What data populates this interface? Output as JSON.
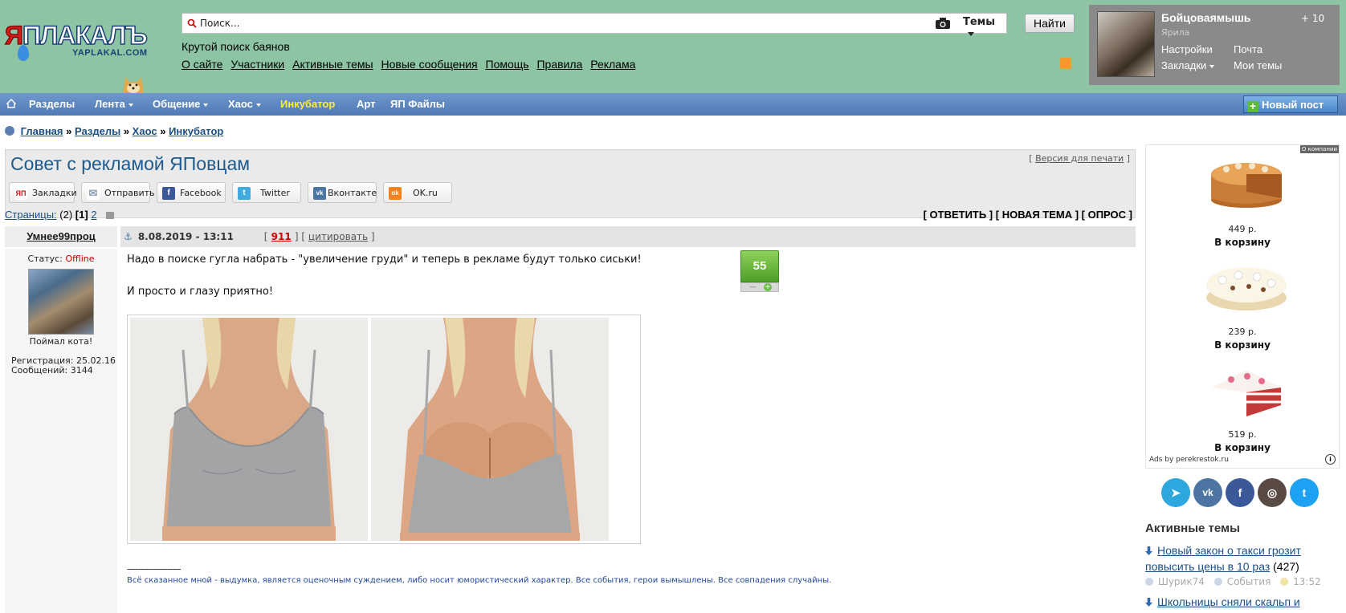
{
  "logo": {
    "main": "ЯПЛАКАЛЪ",
    "sub": "YAPLAKAL.COM"
  },
  "search": {
    "placeholder": "Поиск...",
    "scope_label": "Темы",
    "button": "Найти"
  },
  "tagline": "Крутой поиск баянов",
  "top_nav": [
    "О сайте",
    "Участники",
    "Активные темы",
    "Новые сообщения",
    "Помощь",
    "Правила",
    "Реклама"
  ],
  "user_panel": {
    "name": "Бойцоваямышь",
    "sub": "Ярила",
    "settings": "Настройки",
    "mail": "Почта",
    "bookmarks": "Закладки",
    "my_topics": "Мои темы",
    "icons_text": "+ 10"
  },
  "main_nav": [
    {
      "label": "Разделы",
      "caret": false
    },
    {
      "label": "Лента",
      "caret": true
    },
    {
      "label": "Общение",
      "caret": true
    },
    {
      "label": "Хаос",
      "caret": true
    },
    {
      "label": "Инкубатор",
      "caret": false,
      "highlight": true
    },
    {
      "label": "Арт",
      "caret": false
    },
    {
      "label": "ЯП Файлы",
      "caret": false
    }
  ],
  "new_post_button": "Новый пост",
  "breadcrumb": [
    "Главная",
    "Разделы",
    "Хаос",
    "Инкубатор"
  ],
  "breadcrumb_sep": "»",
  "topic": {
    "title": "Совет с рекламой ЯПовцам",
    "print_version": "Версия для печати",
    "share": [
      {
        "label": "Закладки",
        "icon": "yap-icon",
        "color": "#c41a1a",
        "glyph": "ЯП"
      },
      {
        "label": "Отправить",
        "icon": "mail-icon",
        "color": "#8aa0b8",
        "glyph": "✉"
      },
      {
        "label": "Facebook",
        "icon": "facebook-icon",
        "color": "#3b5998",
        "glyph": "f"
      },
      {
        "label": "Twitter",
        "icon": "twitter-icon",
        "color": "#41abe1",
        "glyph": "t"
      },
      {
        "label": "Вконтакте",
        "icon": "vk-icon",
        "color": "#4c75a3",
        "glyph": "vk"
      },
      {
        "label": "OK.ru",
        "icon": "ok-icon",
        "color": "#f2811f",
        "glyph": "ok"
      }
    ],
    "pages_label": "Страницы:",
    "pages_count": "(2)",
    "current_page": "[1]",
    "next_page": "2",
    "actions": "[ ОТВЕТИТЬ ] [ НОВАЯ ТЕМА ] [ ОПРОС ]"
  },
  "post": {
    "author": "Умнее99проц",
    "date": "8.08.2019 - 13:11",
    "number": "911",
    "quote": "цитировать",
    "status_label": "Статус:",
    "status_value": "Offline",
    "avatar_caption": "Поймал кота!",
    "registration": "Регистрация: 25.02.16",
    "messages": "Сообщений: 3144",
    "text1": "Надо в поиске гугла набрать - \"увеличение груди\" и теперь в рекламе будут только сиськи!",
    "text2": "И просто и глазу приятно!",
    "rating": "55",
    "signature_sep": "--------------------",
    "signature": "Всё сказанное мной - выдумка, является оценочным суждением, либо носит юмористический характер. Все события, герои вымышлены. Все совпадения случайны."
  },
  "ad": {
    "flag": "О компании",
    "products": [
      {
        "price": "449 р.",
        "cart": "В корзину"
      },
      {
        "price": "239 р.",
        "cart": "В корзину"
      },
      {
        "price": "519 р.",
        "cart": "В корзину"
      }
    ],
    "footer": "Ads by perekrestok.ru"
  },
  "social": [
    {
      "icon": "telegram-icon",
      "color": "#2ea6de",
      "glyph": "➤"
    },
    {
      "icon": "vk-icon",
      "color": "#4c75a3",
      "glyph": "vk"
    },
    {
      "icon": "facebook-icon",
      "color": "#3b5998",
      "glyph": "f"
    },
    {
      "icon": "instagram-icon",
      "color": "#5a4a44",
      "glyph": "◎"
    },
    {
      "icon": "twitter-icon",
      "color": "#1da1f2",
      "glyph": "t"
    }
  ],
  "active_topics": {
    "title": "Активные темы",
    "items": [
      {
        "text": "Новый закон о такси грозит повысить цены в 10 раз",
        "count": "(427)",
        "author": "Шурик74",
        "section": "События",
        "time": "13:52"
      },
      {
        "text": "Школьницы сняли скальп и"
      }
    ]
  }
}
